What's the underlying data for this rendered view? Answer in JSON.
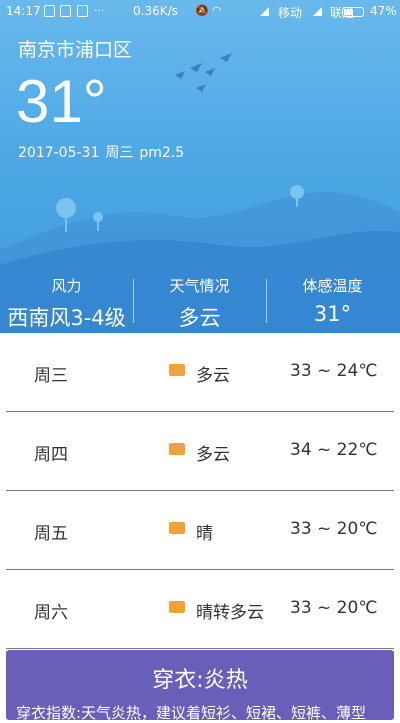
{
  "status_bar": {
    "time": "14:17",
    "network_speed": "0.36K/s",
    "carrier_1": "移动",
    "carrier_2": "联通",
    "battery": "47%"
  },
  "location": "南京市浦口区",
  "current_temp": "31°",
  "date": "2017-05-31",
  "weekday": "周三",
  "air_label": "pm2.5",
  "stats": [
    {
      "label": "风力",
      "value": "西南风3-4级"
    },
    {
      "label": "天气情况",
      "value": "多云"
    },
    {
      "label": "体感温度",
      "value": "31°"
    }
  ],
  "forecast": [
    {
      "day": "周三",
      "icon": "cloudy-sun-icon",
      "weather": "多云",
      "range": "33 ~ 24℃"
    },
    {
      "day": "周四",
      "icon": "cloudy-sun-icon",
      "weather": "多云",
      "range": "34 ~ 22℃"
    },
    {
      "day": "周五",
      "icon": "sun-icon",
      "weather": "晴",
      "range": "33 ~ 20℃"
    },
    {
      "day": "周六",
      "icon": "sun-icon",
      "weather": "晴转多云",
      "range": "33 ~ 20℃"
    }
  ],
  "clothing": {
    "title": "穿衣:炎热",
    "text": "穿衣指数:天气炎热，建议着短衫、短裙、短裤、薄型"
  },
  "colors": {
    "sky_top": "#69b9ec",
    "sky_bottom": "#3d98dc",
    "card": "#6a5fb8",
    "weather_icon": "#f2a23a"
  }
}
